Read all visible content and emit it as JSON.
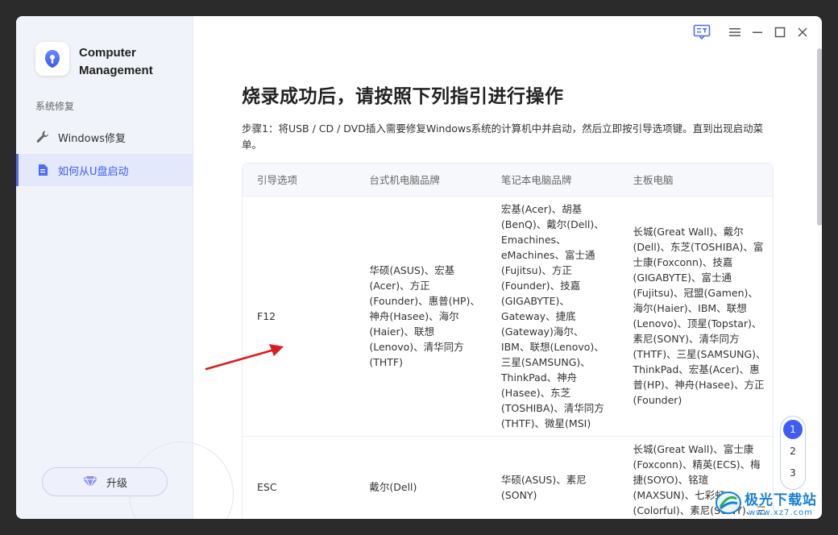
{
  "app": {
    "title": "Computer\nManagement",
    "logo_icon": "lock-logo-icon",
    "accent": "#3f5cf6"
  },
  "sidebar": {
    "section_label": "系统修复",
    "items": [
      {
        "label": "Windows修复",
        "icon": "wrench-icon",
        "active": false
      },
      {
        "label": "如何从U盘启动",
        "icon": "document-icon",
        "active": true
      }
    ],
    "upgrade_label": "升级"
  },
  "main": {
    "heading": "烧录成功后，请按照下列指引进行操作",
    "step_text": "步骤1：将USB / CD / DVD插入需要修复Windows系统的计算机中并启动，然后立即按引导选项键。直到出现启动菜单。",
    "table": {
      "headers": [
        "引导选项",
        "台式机电脑品牌",
        "笔记本电脑品牌",
        "主板电脑"
      ],
      "rows": [
        {
          "key": "F12",
          "desktop": "华硕(ASUS)、宏基(Acer)、方正(Founder)、惠普(HP)、神舟(Hasee)、海尔 (Haier)、联想(Lenovo)、清华同方(THTF)",
          "laptop": "宏基(Acer)、胡基(BenQ)、戴尔(Dell)、Emachines、eMachines、富士通(Fujitsu)、方正(Founder)、技嘉(GIGABYTE)、Gateway、捷底(Gateway)海尔、IBM、联想(Lenovo)、三星(SAMSUNG)、ThinkPad、神舟(Hasee)、东芝(TOSHIBA)、清华同方(THTF)、微星(MSI)",
          "motherboard": "长城(Great Wall)、戴尔(Dell)、东芝(TOSHIBA)、富士康(Foxconn)、技嘉(GIGABYTE)、富士通(Fujitsu)、冠盟(Gamen)、海尔(Haier)、IBM、联想(Lenovo)、顶星(Topstar)、素尼(SONY)、清华同方(THTF)、三星(SAMSUNG)、ThinkPad、宏基(Acer)、惠普(HP)、神舟(Hasee)、方正(Founder)"
        },
        {
          "key": "ESC",
          "desktop": "戴尔(Dell)",
          "laptop": "华硕(ASUS)、素尼(SONY)",
          "motherboard": "长城(Great Wall)、富士康(Foxconn)、精英(ECS)、梅捷(SOYO)、铭瑄(MAXSUN)、七彩虹(Colorful)、素尼(SONY)、三星"
        }
      ]
    },
    "pager": {
      "pages": [
        "1",
        "2",
        "3"
      ],
      "current": "1"
    }
  },
  "window_controls": [
    "feedback-icon",
    "menu-icon",
    "minimize-icon",
    "maximize-icon",
    "close-icon"
  ],
  "watermark": {
    "main": "极光下载站",
    "url": "www.xz7.com"
  }
}
